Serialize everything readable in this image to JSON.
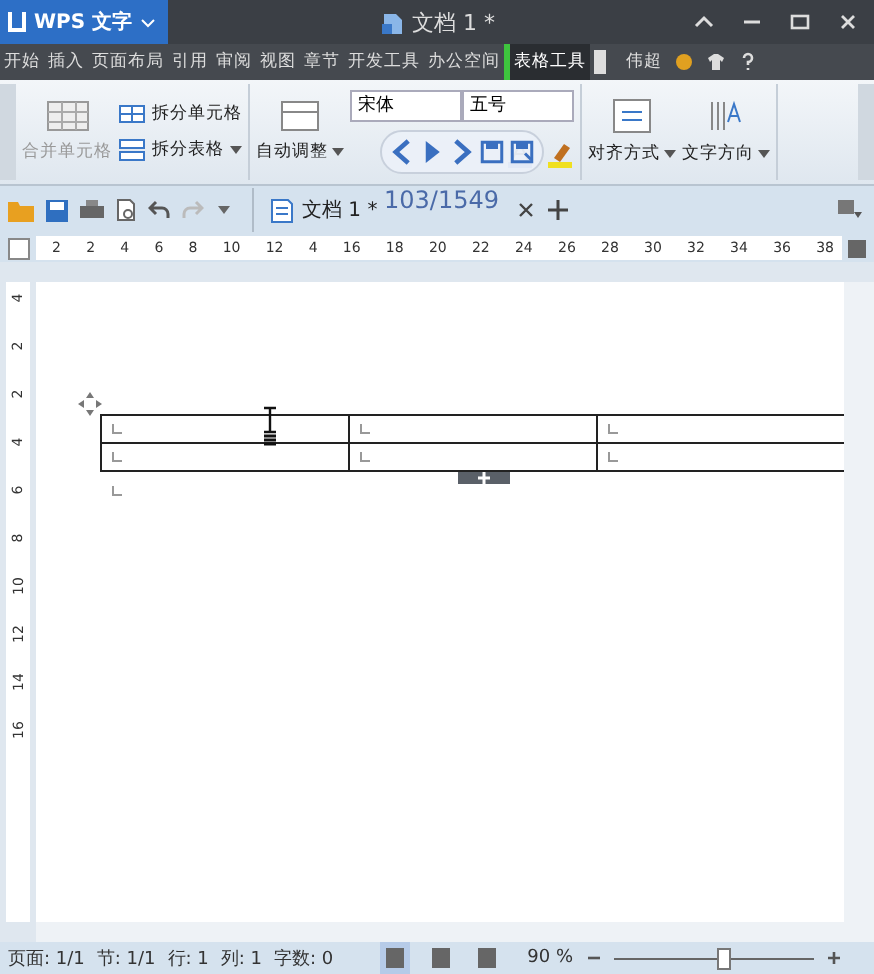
{
  "window": {
    "app_button": "WPS 文字",
    "title": "文档 1 *"
  },
  "menu_tabs": [
    {
      "label": "开始",
      "selected": false
    },
    {
      "label": "插入",
      "selected": false
    },
    {
      "label": "页面布局",
      "selected": false
    },
    {
      "label": "引用",
      "selected": false
    },
    {
      "label": "审阅",
      "selected": false
    },
    {
      "label": "视图",
      "selected": false
    },
    {
      "label": "章节",
      "selected": false
    },
    {
      "label": "开发工具",
      "selected": false
    },
    {
      "label": "办公空间",
      "selected": false
    },
    {
      "label": "表格工具",
      "selected": true
    }
  ],
  "user": "伟超",
  "ribbon": {
    "merge_cells": "合并单元格",
    "split_cells": "拆分单元格",
    "split_table": "拆分表格",
    "autofit": "自动调整",
    "font": "宋体",
    "size": "五号",
    "align": "对齐方式",
    "text_direction": "文字方向"
  },
  "viewer_counter": "103/1549",
  "doc_tab": "文档 1 *",
  "ruler": [
    "2",
    "2",
    "4",
    "6",
    "8",
    "10",
    "12",
    "4",
    "16",
    "18",
    "20",
    "22",
    "24",
    "26",
    "28",
    "30",
    "32",
    "34",
    "36",
    "38"
  ],
  "vruler": [
    "4",
    "2",
    "2",
    "4",
    "6",
    "8",
    "10",
    "12",
    "14",
    "16"
  ],
  "status": [
    {
      "label": "页面: 1/1"
    },
    {
      "label": "节: 1/1"
    },
    {
      "label": "行: 1"
    },
    {
      "label": "列: 1"
    },
    {
      "label": "字数: 0"
    }
  ],
  "zoom": {
    "label": "90 %",
    "level": 0.55
  }
}
